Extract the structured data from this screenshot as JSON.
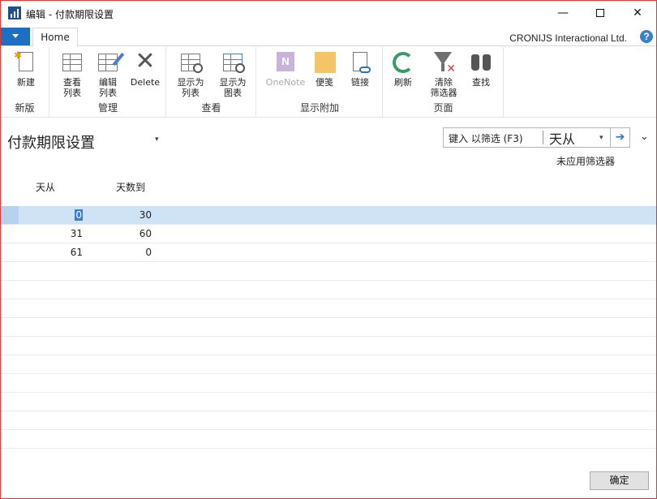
{
  "window": {
    "title": "编辑 - 付款期限设置",
    "controls": {
      "minimize": "—",
      "close": "✕"
    }
  },
  "ribbon": {
    "tab": "Home",
    "company": "CRONIJS Interactional Ltd.",
    "help": "?",
    "groups": [
      {
        "label": "新版",
        "buttons": [
          {
            "label": "新建"
          }
        ]
      },
      {
        "label": "管理",
        "buttons": [
          {
            "label": "查看\n列表"
          },
          {
            "label": "编辑\n列表"
          },
          {
            "label": "Delete"
          }
        ]
      },
      {
        "label": "查看",
        "buttons": [
          {
            "label": "显示为\n列表"
          },
          {
            "label": "显示为\n图表"
          }
        ]
      },
      {
        "label": "显示附加",
        "buttons": [
          {
            "label": "OneNote"
          },
          {
            "label": "便笺"
          },
          {
            "label": "链接"
          }
        ]
      },
      {
        "label": "页面",
        "buttons": [
          {
            "label": "刷新"
          },
          {
            "label": "清除\n筛选器"
          },
          {
            "label": "查找"
          }
        ]
      }
    ],
    "icon_glyphs": {
      "delete": "✕",
      "new_sparkle": "✱",
      "onenote": "N",
      "clear_filter_x": "✕"
    }
  },
  "page": {
    "title": "付款期限设置",
    "title_caret": "▾",
    "filter": {
      "placeholder": "键入 以筛选 (F3)",
      "field": "天从",
      "caret": "▾",
      "go": "➔",
      "status": "未应用筛选器"
    },
    "collapse": "⌄"
  },
  "table": {
    "columns": [
      "天从",
      "天数到"
    ],
    "rows": [
      {
        "from": "0",
        "to": "30",
        "selected": true
      },
      {
        "from": "31",
        "to": "60",
        "selected": false
      },
      {
        "from": "61",
        "to": "0",
        "selected": false
      }
    ]
  },
  "footer": {
    "ok": "确定"
  },
  "colors": {
    "accent": "#1d6fc4",
    "selection": "#cfe3f7",
    "border": "#d43b3b"
  }
}
